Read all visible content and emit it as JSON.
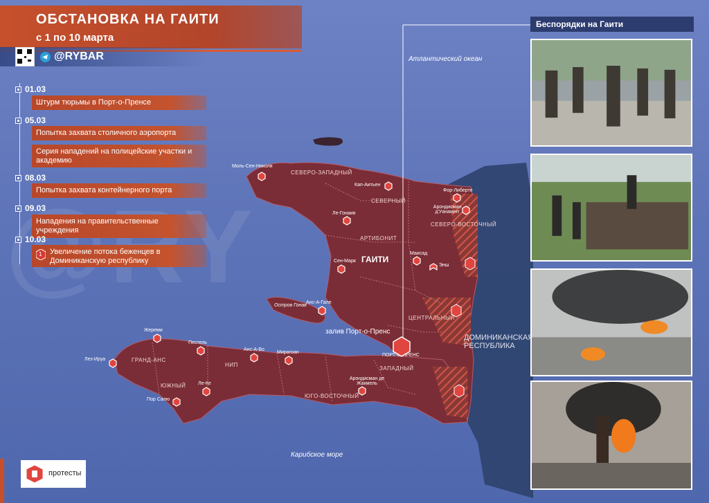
{
  "header": {
    "title": "ОБСТАНОВКА НА ГАИТИ",
    "subtitle": "с 1 по 10 марта",
    "brand": "@RYBAR",
    "watermark": "@RY"
  },
  "timeline": [
    {
      "date": "01.03",
      "events": [
        {
          "text": "Штурм тюрьмы в Порт-о-Пренсе",
          "badge": ""
        }
      ]
    },
    {
      "date": "05.03",
      "events": [
        {
          "text": "Попытка захвата столичного аэропорта",
          "badge": ""
        },
        {
          "text": "Серия нападений на полицейские участки и академию",
          "badge": ""
        }
      ]
    },
    {
      "date": "08.03",
      "events": [
        {
          "text": "Попытка захвата контейнерного порта",
          "badge": ""
        }
      ]
    },
    {
      "date": "09.03",
      "events": [
        {
          "text": "Нападения на правительственные учреждения",
          "badge": ""
        }
      ]
    },
    {
      "date": "10.03",
      "events": [
        {
          "text": "Увеличение потока беженцев в Доминиканскую республику",
          "badge": "1"
        }
      ]
    }
  ],
  "legend": {
    "label": "протесты"
  },
  "panel": {
    "title": "Беспорядки на Гаити"
  },
  "map": {
    "seas": {
      "atlantic": "Атлантический океан",
      "caribbean": "Карибское море",
      "gulf": "залив Порт-о-Пренс"
    },
    "countries": {
      "haiti": "ГАИТИ",
      "dominican": "ДОМИНИКАНСКАЯ РЕСПУБЛИКА"
    },
    "regions": {
      "northwest": "СЕВЕРО-ЗАПАДНЫЙ",
      "north": "СЕВЕРНЫЙ",
      "northeast": "СЕВЕРО-ВОСТОЧНЫЙ",
      "artibonite": "АРТИБОНИТ",
      "center": "ЦЕНТРАЛЬНЫЙ",
      "west": "ЗАПАДНЫЙ",
      "southeast": "ЮГО-ВОСТОЧНЫЙ",
      "south": "ЮЖНЫЙ",
      "grandanse": "ГРАНД-АНС",
      "nippes": "НИП"
    },
    "cities": {
      "molesaintnicolas": "Моль-Сен-Николя",
      "capHaitien": "Кап-Аитьен",
      "fortLiberte": "Фор-Либерте",
      "ouanaminthe": "Арондисман д'Уанамінт",
      "gonaives": "Ле-Гонаив",
      "saintMarc": "Сен-Марк",
      "mirebalais": "Маисад",
      "hinche": "Энш",
      "anseAGalets": "Анс-А-Гале",
      "gonave": "Остров Гонав",
      "portauprince": "ПОРТ-О-ПРЕНС",
      "jacmel": "Арондисман де Жакмель",
      "jeremie": "Жереми",
      "pestel": "Пестель",
      "anseAVeau": "Анс-А-Во",
      "miragoane": "Мирагоан",
      "lesIrois": "Лез-Ируа",
      "lesCayes": "Ле-Ке",
      "portSalut": "Пор Салю"
    }
  }
}
